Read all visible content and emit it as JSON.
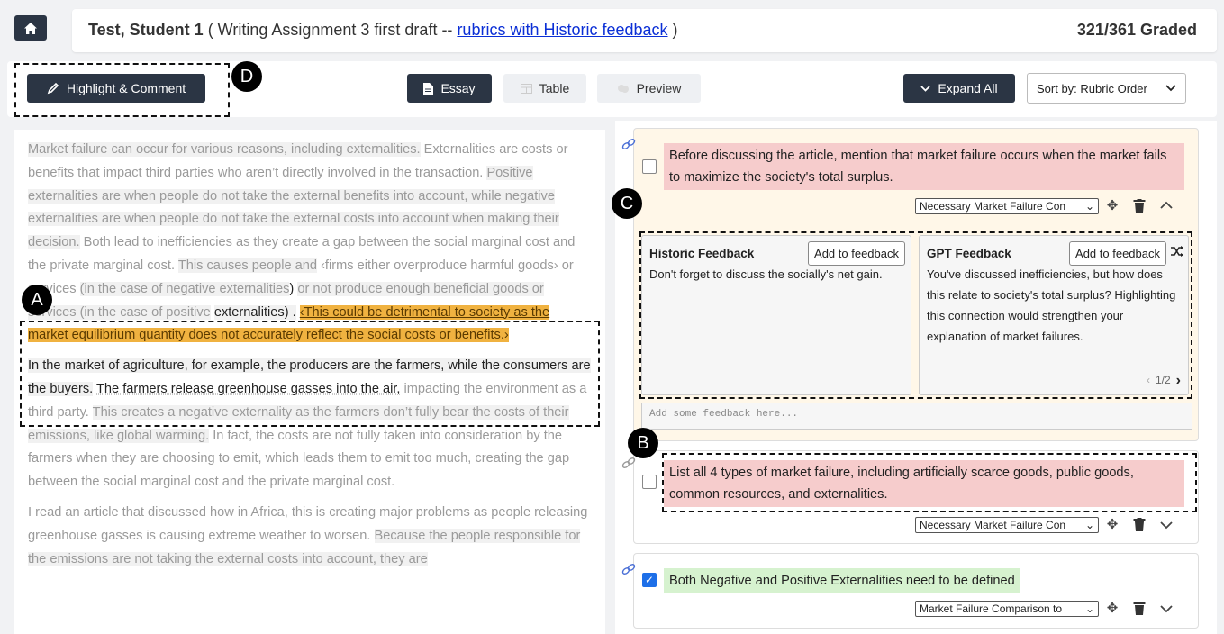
{
  "header": {
    "home_icon": "home-icon",
    "student_name": "Test, Student 1",
    "assignment_prefix": " ( Writing Assignment 3 first draft -- ",
    "assignment_link": "rubrics with Historic feedback",
    "assignment_suffix": " )",
    "graded_count": "321/361 Graded"
  },
  "toolbar": {
    "highlight_label": "Highlight & Comment",
    "essay_label": "Essay",
    "table_label": "Table",
    "preview_label": "Preview",
    "expand_label": "Expand All",
    "sort_label": "Sort by:  Rubric Order"
  },
  "badges": {
    "a": "A",
    "b": "B",
    "c": "C",
    "d": "D"
  },
  "essay": {
    "p1": {
      "s1": "Market failure can occur for various reasons, including externalities.",
      "s2": "Externalities are costs or benefits that impact third parties who aren’t directly involved in the transaction.",
      "s3": "Positive externalities are when people do not take the external benefits into account, while negative externalities are when people do not take the external costs into account when making their decision.",
      "s4": "Both lead to inefficiencies as they create a gap between the social marginal cost and the private marginal cost.",
      "s5a": "This causes people and",
      "s5b": "‹firms either overproduce harmful goods›",
      "s5c": "or services",
      "s5d": "(in the case of negative externalities",
      "s5e": ")",
      "s5f": "or not produce enough beneficial goods or services (in the case of positive",
      "s5g": "externalities) .",
      "s6": "‹This could be detrimental to society as the market equilibrium quantity does not accurately reflect the social costs or benefits.›"
    },
    "p2": {
      "s1": "In the market of agriculture, for example, the producers are the farmers, while the consumers are the buyers.",
      "s2": "The farmers release greenhouse gasses into the air,",
      "s3": "impacting the environment as a third party.",
      "s4": "This creates a negative externality as the farmers don’t fully bear the costs of their emissions, like global warming.",
      "s5": "In fact, the costs are not fully taken into consideration by the farmers when they are choosing to emit, which leads them to emit too much, creating the gap between the social marginal cost and the private marginal cost."
    },
    "p3": {
      "s1": "I read an article that discussed how in Africa, this is creating major problems as people releasing greenhouse gasses is causing extreme weather to worsen.",
      "s2": "Because the people responsible for the emissions are not taking the external costs into account, they are"
    }
  },
  "rubrics": [
    {
      "text": "Before discussing the article, mention that market failure occurs when the market fails to maximize the society's total surplus.",
      "category": "Necessary Market Failure Con",
      "checked": false,
      "historic_title": "Historic Feedback",
      "historic_add": "Add to feedback",
      "historic_text": "Don't forget to discuss the socially's net gain.",
      "gpt_title": "GPT Feedback",
      "gpt_add": "Add to feedback",
      "gpt_text": "You've discussed inefficiencies, but how does this relate to society's total surplus? Highlighting this connection would strengthen your explanation of market failures.",
      "gpt_pager": "1/2",
      "feedback_placeholder": "Add some feedback here..."
    },
    {
      "text": "List all 4 types of market failure, including artificially scarce goods, public goods, common resources, and externalities.",
      "category": "Necessary Market Failure Con",
      "checked": false
    },
    {
      "text": "Both Negative and Positive Externalities need to be defined",
      "category": "Market Failure Comparison to",
      "checked": true
    }
  ],
  "colors": {
    "dark_button": "#2b3544",
    "highlight": "#f0b240",
    "rubric_red": "#f6cccc",
    "rubric_green": "#d6f2cf",
    "link_blue": "#0b2fd6"
  }
}
